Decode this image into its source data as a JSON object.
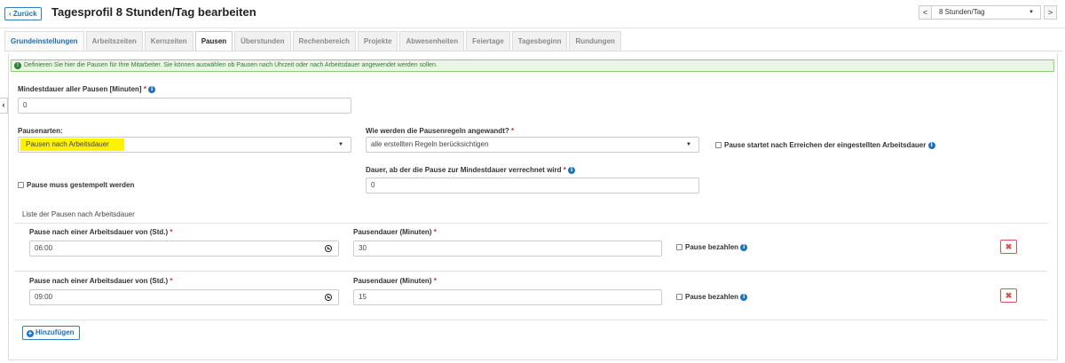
{
  "header": {
    "back_label": "Zurück",
    "title": "Tagesprofil 8 Stunden/Tag bearbeiten",
    "profile_select": "8 Stunden/Tag",
    "prev_glyph": "<",
    "next_glyph": ">"
  },
  "tabs": [
    {
      "label": "Grundeinstellungen"
    },
    {
      "label": "Arbeitszeiten"
    },
    {
      "label": "Kernzeiten"
    },
    {
      "label": "Pausen"
    },
    {
      "label": "Überstunden"
    },
    {
      "label": "Rechenbereich"
    },
    {
      "label": "Projekte"
    },
    {
      "label": "Abwesenheiten"
    },
    {
      "label": "Feiertage"
    },
    {
      "label": "Tagesbeginn"
    },
    {
      "label": "Rundungen"
    }
  ],
  "active_tab": "Pausen",
  "info_alert": "Definieren Sie hier die Pausen für Ihre Mitarbeiter. Sie können auswählen ob Pausen nach Uhrzeit oder nach Arbeitsdauer angewendet werden sollen.",
  "form": {
    "min_duration_label": "Mindestdauer aller Pausen [Minuten]",
    "min_duration_value": "0",
    "pause_types_label": "Pausenarten:",
    "pause_types_value": "Pausen nach Arbeitsdauer",
    "rules_label": "Wie werden die Pausenregeln angewandt?",
    "rules_value": "alle erstellten Regeln berücksichtigen",
    "start_after_label": "Pause startet nach Erreichen der eingestellten Arbeitsdauer",
    "stamp_label": "Pause muss gestempelt werden",
    "duration_threshold_label": "Dauer, ab der die Pause zur Mindestdauer verrechnet wird",
    "duration_threshold_value": "0",
    "required_mark": "*"
  },
  "list": {
    "title": "Liste der Pausen nach Arbeitsdauer",
    "after_label": "Pause nach einer Arbeitsdauer von (Std.)",
    "duration_label": "Pausendauer (Minuten)",
    "pay_label": "Pause bezahlen",
    "rows": [
      {
        "after": "06:00",
        "duration": "30"
      },
      {
        "after": "09:00",
        "duration": "15"
      }
    ],
    "add_label": "Hinzufügen",
    "delete_glyph": "✖"
  },
  "colors": {
    "accent": "#1e73be",
    "highlight": "#fff200",
    "alert_bg": "#e9f6e4",
    "danger": "#d9534f"
  }
}
